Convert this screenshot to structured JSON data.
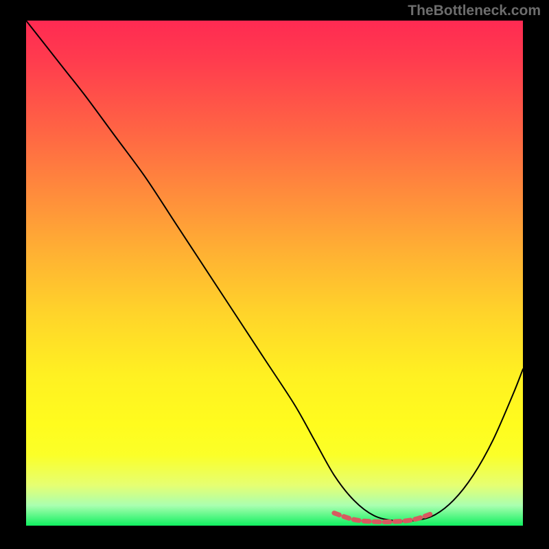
{
  "watermark": "TheBottleneck.com",
  "chart_data": {
    "type": "line",
    "title": "",
    "xlabel": "",
    "ylabel": "",
    "xlim": [
      0,
      100
    ],
    "ylim": [
      0,
      100
    ],
    "grid": false,
    "legend": false,
    "series": [
      {
        "name": "bottleneck-curve",
        "color": "#000000",
        "stroke_width": 2,
        "x": [
          0,
          4,
          8,
          12,
          18,
          24,
          30,
          36,
          42,
          48,
          54,
          58,
          62,
          66,
          70,
          74,
          78,
          82,
          86,
          90,
          94,
          98,
          100
        ],
        "y": [
          100,
          95,
          90,
          85,
          77,
          69,
          60,
          51,
          42,
          33,
          24,
          17,
          10,
          5,
          2,
          1,
          1,
          2,
          5,
          10,
          17,
          26,
          31
        ]
      },
      {
        "name": "optimal-range-marker",
        "color": "#d85a60",
        "stroke_width": 7,
        "stroke_dasharray": "8 7",
        "x": [
          62,
          66,
          70,
          74,
          78,
          82
        ],
        "y": [
          2.5,
          1.2,
          0.8,
          0.8,
          1.2,
          2.5
        ]
      }
    ],
    "background_gradient_stops": [
      {
        "offset": 0.0,
        "color": "#ff2a52"
      },
      {
        "offset": 0.5,
        "color": "#ffd42a"
      },
      {
        "offset": 0.85,
        "color": "#fbff28"
      },
      {
        "offset": 1.0,
        "color": "#10f060"
      }
    ]
  }
}
